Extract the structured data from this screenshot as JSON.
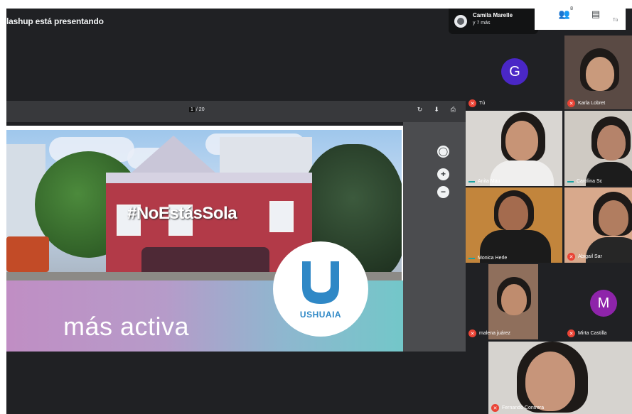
{
  "presenter_text": "lashup está presentando",
  "owner_chip": {
    "name": "Camila Marelle",
    "sub": "y 7 más"
  },
  "top_right": {
    "people_count": "8",
    "label": "Tú"
  },
  "viewer": {
    "page_indicator": "1"
  },
  "slide": {
    "hashtag": "#NoEstásSola",
    "banner": "más activa",
    "logo_text": "USHUAIA"
  },
  "participants": [
    {
      "name": "Tú",
      "avatar_letter": "G",
      "avatar_color": "#4a27c6"
    },
    {
      "name": "Karla Lobret"
    },
    {
      "name": "Anita Mau"
    },
    {
      "name": "Carolina Sc"
    },
    {
      "name": "Monica Herle"
    },
    {
      "name": "Abigail Sar"
    },
    {
      "name": "malena juárez"
    },
    {
      "name": "Mirta Castilla",
      "avatar_letter": "M",
      "avatar_color": "#8e24aa"
    },
    {
      "name": "Fernando Contrera"
    }
  ],
  "colors": {
    "meet_bg": "#202124",
    "mic_off": "#ea4335",
    "talking": "#1aa3a3"
  }
}
